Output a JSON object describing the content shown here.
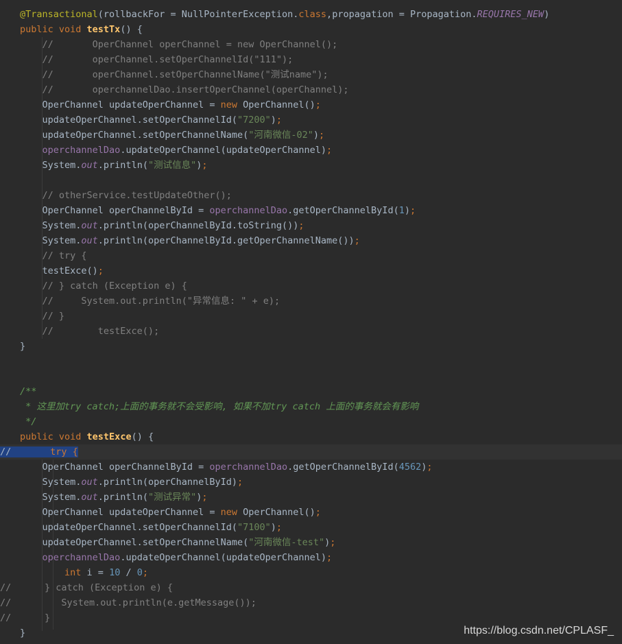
{
  "lines": [
    [
      {
        "t": "@Transactional",
        "c": "ann"
      },
      {
        "t": "(rollbackFor = NullPointerException."
      },
      {
        "t": "class",
        "c": "kw"
      },
      {
        "t": ","
      },
      {
        "t": "propagation = Propagation."
      },
      {
        "t": "REQUIRES_NEW",
        "c": "stat"
      },
      {
        "t": ")"
      }
    ],
    [
      {
        "t": "public void ",
        "c": "kw"
      },
      {
        "t": "testTx",
        "c": "fn"
      },
      {
        "t": "() {"
      }
    ],
    [
      {
        "t": "    //       OperChannel operChannel = new OperChannel();",
        "c": "cmt"
      }
    ],
    [
      {
        "t": "    //       operChannel.setOperChannelId(\"111\");",
        "c": "cmt"
      }
    ],
    [
      {
        "t": "    //       operChannel.setOperChannelName(\"测试name\");",
        "c": "cmt"
      }
    ],
    [
      {
        "t": "    //       operchannelDao.insertOperChannel(operChannel);",
        "c": "cmt"
      }
    ],
    [
      {
        "t": "    OperChannel updateOperChannel = "
      },
      {
        "t": "new ",
        "c": "kw"
      },
      {
        "t": "OperChannel()"
      },
      {
        "t": ";",
        "c": "kw"
      }
    ],
    [
      {
        "t": "    updateOperChannel.setOperChannelId("
      },
      {
        "t": "\"7200\"",
        "c": "str"
      },
      {
        "t": ")"
      },
      {
        "t": ";",
        "c": "kw"
      }
    ],
    [
      {
        "t": "    updateOperChannel.setOperChannelName("
      },
      {
        "t": "\"河南微信-02\"",
        "c": "str"
      },
      {
        "t": ")"
      },
      {
        "t": ";",
        "c": "kw"
      }
    ],
    [
      {
        "t": "    "
      },
      {
        "t": "operchannelDao",
        "c": "fld"
      },
      {
        "t": ".updateOperChannel(updateOperChannel)"
      },
      {
        "t": ";",
        "c": "kw"
      }
    ],
    [
      {
        "t": "    System."
      },
      {
        "t": "out",
        "c": "stat"
      },
      {
        "t": ".println("
      },
      {
        "t": "\"测试信息\"",
        "c": "str"
      },
      {
        "t": ")"
      },
      {
        "t": ";",
        "c": "kw"
      }
    ],
    [
      {
        "t": ""
      }
    ],
    [
      {
        "t": "    // otherService.testUpdateOther();",
        "c": "cmt"
      }
    ],
    [
      {
        "t": "    OperChannel operChannelById = "
      },
      {
        "t": "operchannelDao",
        "c": "fld"
      },
      {
        "t": ".getOperChannelById("
      },
      {
        "t": "1",
        "c": "num"
      },
      {
        "t": ")"
      },
      {
        "t": ";",
        "c": "kw"
      }
    ],
    [
      {
        "t": "    System."
      },
      {
        "t": "out",
        "c": "stat"
      },
      {
        "t": ".println(operChannelById.toString())"
      },
      {
        "t": ";",
        "c": "kw"
      }
    ],
    [
      {
        "t": "    System."
      },
      {
        "t": "out",
        "c": "stat"
      },
      {
        "t": ".println(operChannelById.getOperChannelName())"
      },
      {
        "t": ";",
        "c": "kw"
      }
    ],
    [
      {
        "t": "    // try {",
        "c": "cmt"
      }
    ],
    [
      {
        "t": "    testExce()"
      },
      {
        "t": ";",
        "c": "kw"
      }
    ],
    [
      {
        "t": "    // } catch (Exception e) {",
        "c": "cmt"
      }
    ],
    [
      {
        "t": "    //     System.out.println(\"异常信息: \" + e);",
        "c": "cmt"
      }
    ],
    [
      {
        "t": "    // }",
        "c": "cmt"
      }
    ],
    [
      {
        "t": "    //        testExce();",
        "c": "cmt"
      }
    ],
    [
      {
        "t": "}"
      }
    ],
    [
      {
        "t": ""
      }
    ],
    [
      {
        "t": ""
      }
    ],
    [
      {
        "t": "/**",
        "c": "doc"
      }
    ],
    [
      {
        "t": " * 这里加",
        "c": "doc"
      },
      {
        "t": "try catch",
        "c": "doc"
      },
      {
        "t": ";上面的事务就不会受影响, 如果不加",
        "c": "doc"
      },
      {
        "t": "try catch ",
        "c": "doc"
      },
      {
        "t": "上面的事务就会有影响",
        "c": "doc"
      }
    ],
    [
      {
        "t": " */",
        "c": "doc"
      }
    ],
    [
      {
        "t": "public void ",
        "c": "kw"
      },
      {
        "t": "testExce",
        "c": "fn"
      },
      {
        "t": "() {"
      }
    ],
    [
      {
        "t": "//     "
      },
      {
        "t": "  try {",
        "c": "kw"
      }
    ],
    [
      {
        "t": "    OperChannel operChannelById = "
      },
      {
        "t": "operchannelDao",
        "c": "fld"
      },
      {
        "t": ".getOperChannelById("
      },
      {
        "t": "4562",
        "c": "num"
      },
      {
        "t": ")"
      },
      {
        "t": ";",
        "c": "kw"
      }
    ],
    [
      {
        "t": "    System."
      },
      {
        "t": "out",
        "c": "stat"
      },
      {
        "t": ".println(operChannelById)"
      },
      {
        "t": ";",
        "c": "kw"
      }
    ],
    [
      {
        "t": "    System."
      },
      {
        "t": "out",
        "c": "stat"
      },
      {
        "t": ".println("
      },
      {
        "t": "\"测试异常\"",
        "c": "str"
      },
      {
        "t": ")"
      },
      {
        "t": ";",
        "c": "kw"
      }
    ],
    [
      {
        "t": "    OperChannel updateOperChannel = "
      },
      {
        "t": "new ",
        "c": "kw"
      },
      {
        "t": "OperChannel()"
      },
      {
        "t": ";",
        "c": "kw"
      }
    ],
    [
      {
        "t": "    updateOperChannel.setOperChannelId("
      },
      {
        "t": "\"7100\"",
        "c": "str"
      },
      {
        "t": ")"
      },
      {
        "t": ";",
        "c": "kw"
      }
    ],
    [
      {
        "t": "    updateOperChannel.setOperChannelName("
      },
      {
        "t": "\"河南微信-test\"",
        "c": "str"
      },
      {
        "t": ")"
      },
      {
        "t": ";",
        "c": "kw"
      }
    ],
    [
      {
        "t": "    "
      },
      {
        "t": "operchannelDao",
        "c": "fld"
      },
      {
        "t": ".updateOperChannel(updateOperChannel)"
      },
      {
        "t": ";",
        "c": "kw"
      }
    ],
    [
      {
        "t": "        "
      },
      {
        "t": "int ",
        "c": "kw"
      },
      {
        "t": "i = "
      },
      {
        "t": "10",
        "c": "num"
      },
      {
        "t": " / "
      },
      {
        "t": "0",
        "c": "num"
      },
      {
        "t": ";",
        "c": "kw"
      }
    ],
    [
      {
        "t": "//      } catch (Exception e) {",
        "c": "cmt"
      }
    ],
    [
      {
        "t": "//         System.out.println(e.getMessage());",
        "c": "cmt"
      }
    ],
    [
      {
        "t": "//      }",
        "c": "cmt"
      }
    ],
    [
      {
        "t": "}"
      }
    ]
  ],
  "watermark": "https://blog.csdn.net/CPLASF_"
}
